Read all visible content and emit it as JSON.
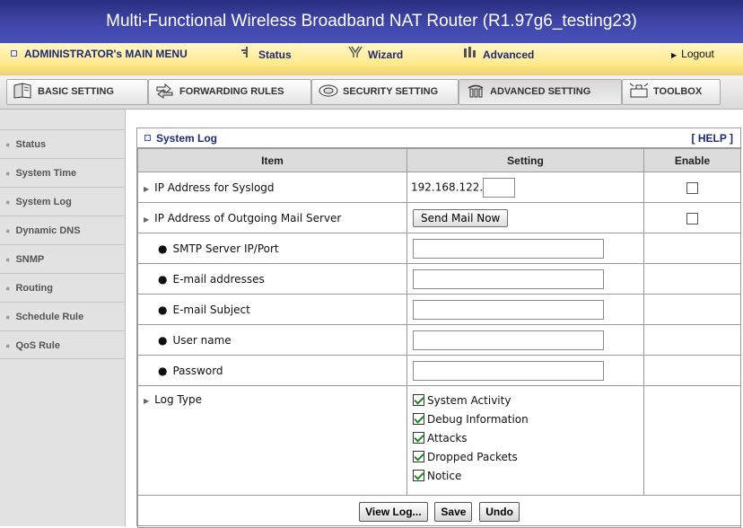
{
  "header": {
    "title": "Multi-Functional Wireless Broadband NAT Router (R1.97g6_testing23)"
  },
  "menu": {
    "admin_label": "ADMINISTRATOR's MAIN MENU",
    "status_label": "Status",
    "wizard_label": "Wizard",
    "advanced_label": "Advanced",
    "logout_label": "Logout"
  },
  "tabs": [
    {
      "label": "BASIC SETTING",
      "icon": "book-icon"
    },
    {
      "label": "FORWARDING RULES",
      "icon": "arrows-icon"
    },
    {
      "label": "SECURITY SETTING",
      "icon": "shield-icon"
    },
    {
      "label": "ADVANCED SETTING",
      "icon": "advanced-icon"
    },
    {
      "label": "TOOLBOX",
      "icon": "toolbox-icon"
    }
  ],
  "sidebar": {
    "items": [
      {
        "label": "Status"
      },
      {
        "label": "System Time"
      },
      {
        "label": "System Log"
      },
      {
        "label": "Dynamic DNS"
      },
      {
        "label": "SNMP"
      },
      {
        "label": "Routing"
      },
      {
        "label": "Schedule Rule"
      },
      {
        "label": "QoS Rule"
      }
    ]
  },
  "panel": {
    "title": "System Log",
    "help": "[ HELP ]",
    "columns": {
      "item": "Item",
      "setting": "Setting",
      "enable": "Enable"
    },
    "rows": {
      "syslogd_label": "IP Address for Syslogd",
      "syslogd_prefix": "192.168.122.",
      "syslogd_value": "",
      "mail_server_label": "IP Address of Outgoing Mail Server",
      "send_mail_button": "Send Mail Now",
      "smtp_label": "SMTP Server IP/Port",
      "smtp_value": "",
      "email_label": "E-mail addresses",
      "email_value": "",
      "subject_label": "E-mail Subject",
      "subject_value": "",
      "username_label": "User name",
      "username_value": "",
      "password_label": "Password",
      "password_value": "",
      "logtype_label": "Log Type",
      "logtype_options": [
        {
          "label": "System Activity",
          "checked": true
        },
        {
          "label": "Debug Information",
          "checked": true
        },
        {
          "label": "Attacks",
          "checked": true
        },
        {
          "label": "Dropped Packets",
          "checked": true
        },
        {
          "label": "Notice",
          "checked": true
        }
      ]
    },
    "buttons": {
      "view_log": "View Log...",
      "save": "Save",
      "undo": "Undo"
    }
  },
  "colors": {
    "title_bar": "#3f46a8",
    "menu_bar": "#ffe98a",
    "menu_text": "#1e2a70",
    "sidebar_bg": "#e2e2e2",
    "header_cell": "#dcdcdc"
  }
}
